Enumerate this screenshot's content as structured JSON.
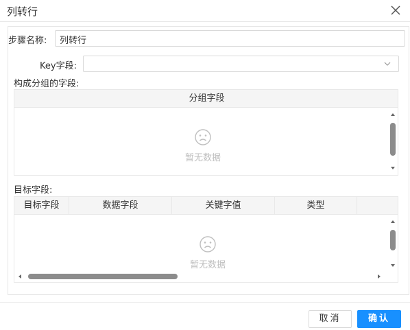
{
  "dialog": {
    "title": "列转行",
    "buttons": {
      "cancel": "取消",
      "ok": "确认"
    }
  },
  "form": {
    "step_name_label": "步骤名称:",
    "step_name_value": "列转行",
    "key_field_label": "Key字段:",
    "key_field_value": "",
    "group_section_label": "构成分组的字段:",
    "target_section_label": "目标字段:"
  },
  "group_table": {
    "columns": [
      "分组字段"
    ],
    "empty_text": "暂无数据"
  },
  "target_table": {
    "columns": [
      "目标字段",
      "数据字段",
      "关键字值",
      "类型"
    ],
    "empty_text": "暂无数据"
  },
  "colors": {
    "primary": "#1890ff",
    "border": "#d9d9d9",
    "header_bg": "#f5f5f5",
    "empty_text": "#bfbfbf"
  },
  "icons": [
    "close-icon",
    "chevron-down-icon",
    "sad-face-icon",
    "scroll-arrow-icon"
  ]
}
